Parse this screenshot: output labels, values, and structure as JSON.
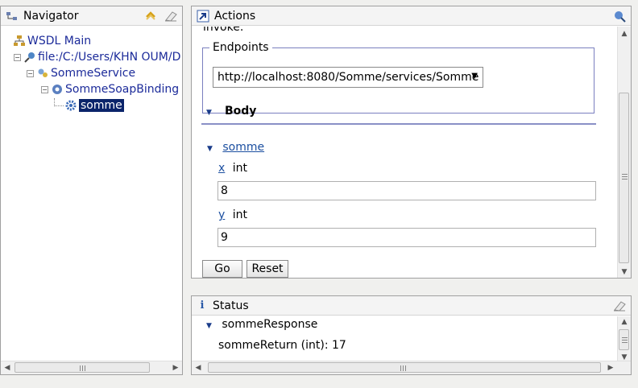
{
  "navigator": {
    "title": "Navigator",
    "tree": [
      {
        "label": "WSDL Main"
      },
      {
        "label": "file:/C:/Users/KHN OUM/D"
      },
      {
        "label": "SommeService"
      },
      {
        "label": "SommeSoapBinding"
      },
      {
        "label": "somme",
        "selected": true
      }
    ]
  },
  "actions": {
    "title": "Actions",
    "cutoff_text": "invoke.",
    "endpoints_legend": "Endpoints",
    "endpoint_value": "http://localhost:8080/Somme/services/Somme",
    "body_header": "Body",
    "operation": "somme",
    "params": [
      {
        "name": "x",
        "type": "int",
        "value": "8"
      },
      {
        "name": "y",
        "type": "int",
        "value": "9"
      }
    ],
    "go_label": "Go",
    "reset_label": "Reset"
  },
  "status": {
    "title": "Status",
    "response": "sommeResponse",
    "result": "sommeReturn (int):  17"
  },
  "colors": {
    "link": "#1c2b9a",
    "selection": "#0a246a",
    "accent_border": "#7a7fbf"
  }
}
